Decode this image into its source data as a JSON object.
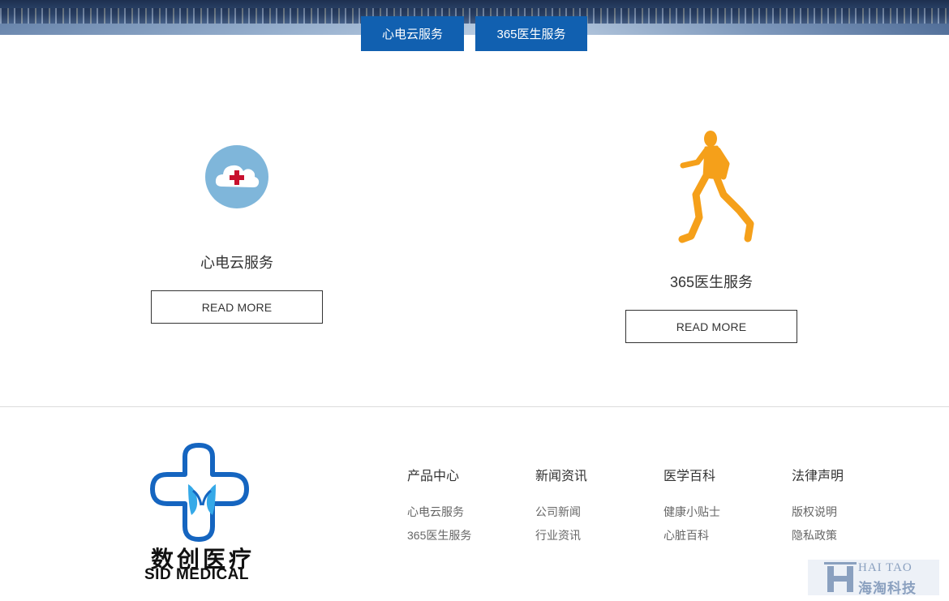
{
  "tabs": [
    {
      "label": "心电云服务"
    },
    {
      "label": "365医生服务"
    }
  ],
  "services": [
    {
      "title": "心电云服务",
      "button": "READ MORE",
      "icon": "medical-cloud-icon",
      "icon_color": "#7fb6da"
    },
    {
      "title": "365医生服务",
      "button": "READ MORE",
      "icon": "runner-icon",
      "icon_color": "#f5a01a"
    }
  ],
  "logo": {
    "cn": "数创医疗",
    "en": "SID MEDICAL"
  },
  "footer": [
    {
      "heading": "产品中心",
      "links": [
        "心电云服务",
        "365医生服务"
      ]
    },
    {
      "heading": "新闻资讯",
      "links": [
        "公司新闻",
        "行业资讯"
      ]
    },
    {
      "heading": "医学百科",
      "links": [
        "健康小贴士",
        "心脏百科"
      ]
    },
    {
      "heading": "法律声明",
      "links": [
        "版权说明",
        "隐私政策"
      ]
    }
  ],
  "watermark": {
    "en": "HAI TAO",
    "cn": "海淘科技"
  },
  "colors": {
    "accent": "#1160b0",
    "runner": "#f5a01a",
    "cloud_circle": "#7fb6da",
    "cross": "#c8102e"
  }
}
